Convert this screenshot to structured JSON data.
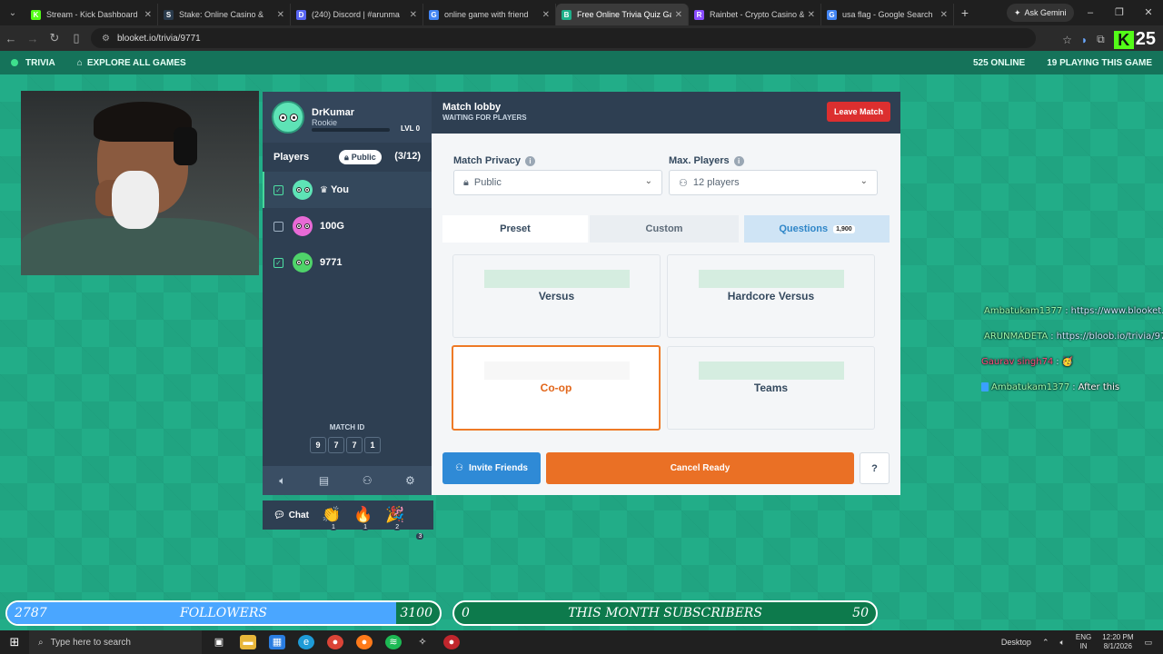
{
  "browser": {
    "tabs": [
      {
        "title": "Stream - Kick Dashboard",
        "color": "#53fc18",
        "glyph": "K"
      },
      {
        "title": "Stake: Online Casino &",
        "color": "#2a3b4c",
        "glyph": "S"
      },
      {
        "title": "(240) Discord | #arunma",
        "color": "#5865f2",
        "glyph": "D"
      },
      {
        "title": "online game with friend",
        "color": "#4285f4",
        "glyph": "G"
      },
      {
        "title": "Free Online Trivia Quiz Gam",
        "color": "#1fb08a",
        "glyph": "B"
      },
      {
        "title": "Rainbet - Crypto Casino &",
        "color": "#8a4dff",
        "glyph": "R"
      },
      {
        "title": "usa flag - Google Search",
        "color": "#4285f4",
        "glyph": "G"
      }
    ],
    "active_tab": 4,
    "ask_gemini": "Ask Gemini",
    "url": "blooket.io/trivia/9771"
  },
  "kick_badge": "25",
  "sitenav": {
    "game": "TRIVIA",
    "explore": "EXPLORE ALL GAMES",
    "online": "525 ONLINE",
    "playing": "19 PLAYING THIS GAME"
  },
  "profile": {
    "name": "DrKumar",
    "rank": "Rookie",
    "level": "LVL 0"
  },
  "players": {
    "heading": "Players",
    "privacy_pill": "Public",
    "count": "(3/12)",
    "list": [
      {
        "name": "You",
        "crown": "♛",
        "checked": true,
        "color": "#5ee3b6"
      },
      {
        "name": "100G",
        "crown": "",
        "checked": false,
        "color": "#e86ad6"
      },
      {
        "name": "9771",
        "crown": "",
        "checked": true,
        "color": "#4fd36a"
      }
    ]
  },
  "match_id": {
    "label": "MATCH ID",
    "digits": [
      "9",
      "7",
      "7",
      "1"
    ]
  },
  "chat": {
    "label": "Chat",
    "reactions": [
      {
        "emoji": "👏",
        "count": "1"
      },
      {
        "emoji": "🔥",
        "count": "1"
      },
      {
        "emoji": "🎉",
        "count": "2"
      },
      {
        "emoji": "",
        "count": "3"
      }
    ]
  },
  "lobby": {
    "title": "Match lobby",
    "subtitle": "WAITING FOR PLAYERS",
    "leave": "Leave Match",
    "privacy_label": "Match Privacy",
    "privacy_value": "Public",
    "max_label": "Max. Players",
    "max_value": "12 players",
    "tabs": {
      "preset": "Preset",
      "custom": "Custom",
      "questions": "Questions",
      "questions_count": "1,900"
    },
    "modes": [
      "Versus",
      "Hardcore Versus",
      "Co-op",
      "Teams"
    ],
    "selected_mode": "Co-op",
    "invite": "Invite Friends",
    "cancel": "Cancel Ready",
    "help": "?"
  },
  "stream_chat": [
    {
      "user": "Ambatukam1377",
      "msg": "https://www.blooket.com/"
    },
    {
      "user": "ARUNMADETA",
      "msg": "https://bloob.io/trivia/9771"
    },
    {
      "user": "Gaurav singh74",
      "msg": "🥳"
    },
    {
      "user": "Ambatukam1377",
      "msg": "After this"
    }
  ],
  "stream_bars": {
    "followers": {
      "current": "2787",
      "label": "FOLLOWERS",
      "goal": "3100",
      "progress": 0.9
    },
    "subs": {
      "current": "0",
      "label": "THIS MONTH SUBSCRIBERS",
      "goal": "50",
      "progress": 0.0
    }
  },
  "taskbar": {
    "search": "Type here to search",
    "desktop": "Desktop",
    "lang": "ENG",
    "region": "IN",
    "time": "12:20 PM",
    "date": "8/1/2026"
  }
}
